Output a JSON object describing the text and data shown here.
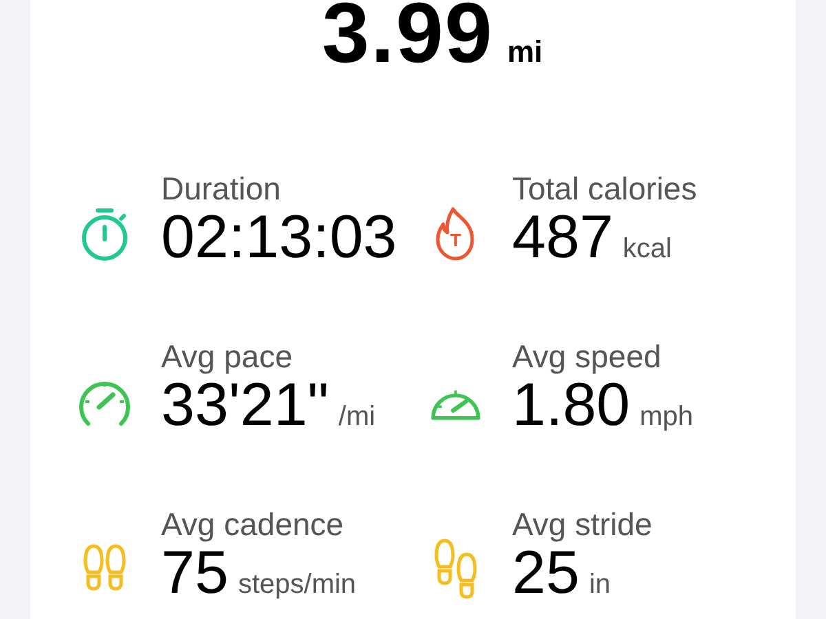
{
  "distance": {
    "value": "3.99",
    "unit": "mi"
  },
  "stats": [
    {
      "kind": "duration",
      "label": "Duration",
      "value": "02:13:03"
    },
    {
      "kind": "calories",
      "label": "Total calories",
      "value": "487",
      "unit": "kcal",
      "badge": "T"
    },
    {
      "kind": "pace",
      "label": "Avg pace",
      "value": "33'21\"",
      "unit": "/mi"
    },
    {
      "kind": "speed",
      "label": "Avg speed",
      "value": "1.80",
      "unit": "mph"
    },
    {
      "kind": "cadence",
      "label": "Avg cadence",
      "value": "75",
      "unit": "steps/min"
    },
    {
      "kind": "stride",
      "label": "Avg stride",
      "value": "25",
      "unit": "in"
    }
  ]
}
